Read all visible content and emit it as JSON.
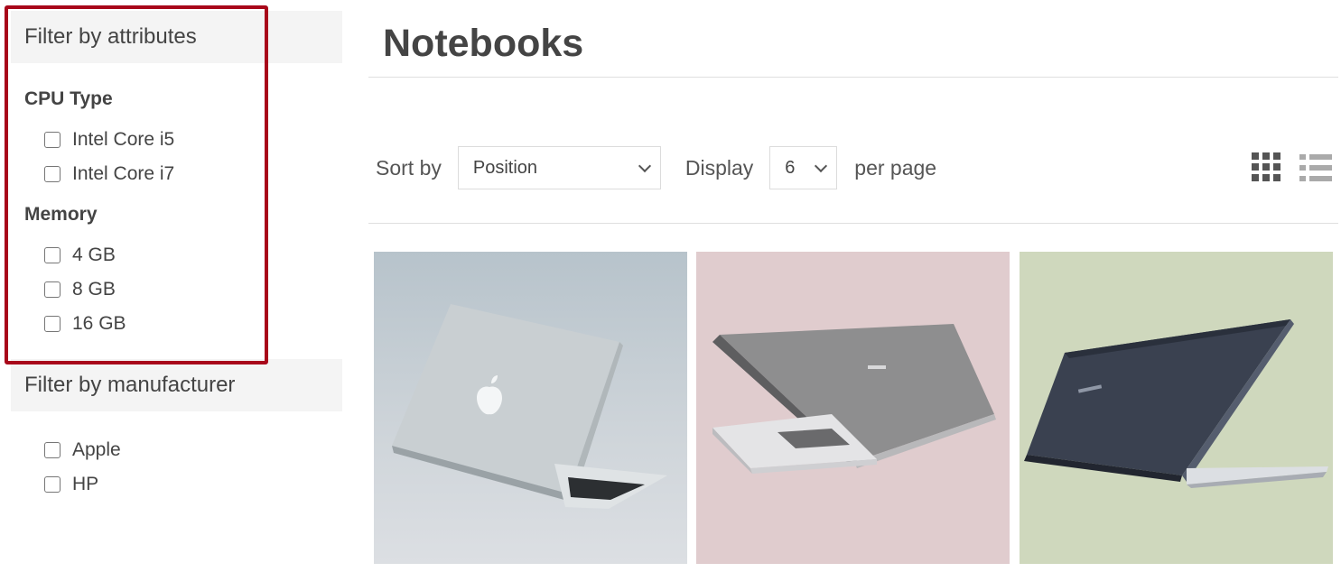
{
  "sidebar": {
    "attributes_title": "Filter by attributes",
    "groups": [
      {
        "title": "CPU Type",
        "options": [
          "Intel Core i5",
          "Intel Core i7"
        ]
      },
      {
        "title": "Memory",
        "options": [
          "4 GB",
          "8 GB",
          "16 GB"
        ]
      }
    ],
    "manufacturer_title": "Filter by manufacturer",
    "manufacturers": [
      "Apple",
      "HP"
    ]
  },
  "main": {
    "title": "Notebooks",
    "sort_label": "Sort by",
    "sort_value": "Position",
    "display_label": "Display",
    "display_value": "6",
    "per_page_label": "per page"
  },
  "icons": {
    "grid_view": "grid-view-icon",
    "list_view": "list-view-icon",
    "dropdown": "chevron-down-icon"
  },
  "colors": {
    "highlight_border": "#a8071a",
    "panel_bg": "#f4f4f4"
  }
}
